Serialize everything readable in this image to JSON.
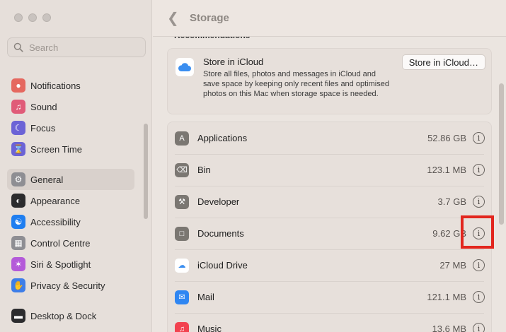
{
  "window": {
    "search_placeholder": "Search"
  },
  "sidebar": {
    "items": [
      {
        "label": "Notifications",
        "icon": "bell-icon",
        "color": "#e5685f"
      },
      {
        "label": "Sound",
        "icon": "speaker-icon",
        "color": "#e05b78"
      },
      {
        "label": "Focus",
        "icon": "moon-icon",
        "color": "#6b63d6"
      },
      {
        "label": "Screen Time",
        "icon": "hourglass-icon",
        "color": "#6b63d6"
      },
      {
        "label": "General",
        "icon": "gear-icon",
        "color": "#8e8e93"
      },
      {
        "label": "Appearance",
        "icon": "appearance-icon",
        "color": "#2c2c2e"
      },
      {
        "label": "Accessibility",
        "icon": "accessibility-icon",
        "color": "#1f7ef0"
      },
      {
        "label": "Control Centre",
        "icon": "control-centre-icon",
        "color": "#8e8e93"
      },
      {
        "label": "Siri & Spotlight",
        "icon": "siri-icon",
        "color": "#b45ad9"
      },
      {
        "label": "Privacy & Security",
        "icon": "hand-icon",
        "color": "#3e7ee8"
      },
      {
        "label": "Desktop & Dock",
        "icon": "dock-icon",
        "color": "#2c2c2e"
      }
    ]
  },
  "header": {
    "title": "Storage"
  },
  "recommendations": {
    "heading": "Recommendations",
    "title": "Store in iCloud",
    "description": "Store all files, photos and messages in iCloud and save space by keeping only recent files and optimised photos on this Mac when storage space is needed.",
    "button_label": "Store in iCloud…"
  },
  "storage": {
    "rows": [
      {
        "name": "Applications",
        "size": "52.86 GB",
        "icon": "applications-icon"
      },
      {
        "name": "Bin",
        "size": "123.1 MB",
        "icon": "trash-icon"
      },
      {
        "name": "Developer",
        "size": "3.7 GB",
        "icon": "hammer-icon"
      },
      {
        "name": "Documents",
        "size": "9.62 GB",
        "icon": "document-icon"
      },
      {
        "name": "iCloud Drive",
        "size": "27 MB",
        "icon": "icloud-icon"
      },
      {
        "name": "Mail",
        "size": "121.1 MB",
        "icon": "mail-icon"
      },
      {
        "name": "Music",
        "size": "13.6 MB",
        "icon": "music-icon"
      }
    ]
  },
  "colors": {
    "highlight": "#e2261e"
  }
}
